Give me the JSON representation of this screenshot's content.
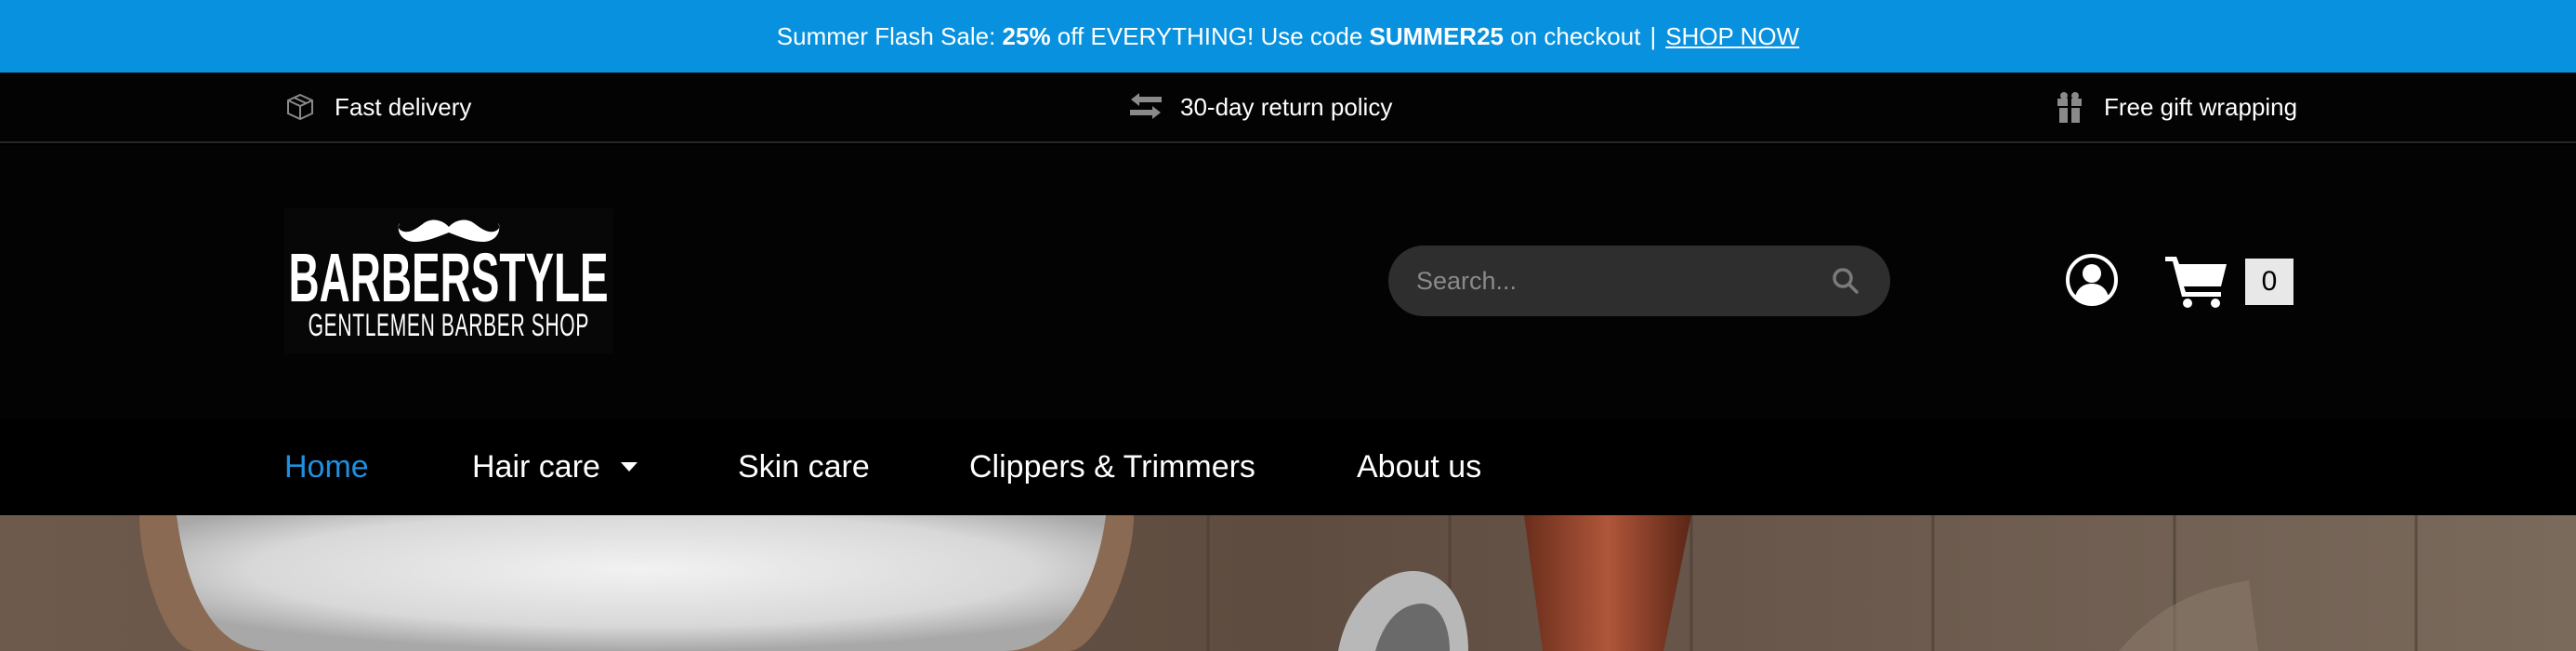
{
  "promo": {
    "prefix": "Summer Flash Sale: ",
    "discount": "25%",
    "middle": " off EVERYTHING! Use code ",
    "code": "SUMMER25",
    "suffix": " on checkout",
    "separator": "|",
    "link": "SHOP NOW",
    "bg_color": "#0891de"
  },
  "features": [
    {
      "label": "Fast delivery",
      "icon": "box-icon"
    },
    {
      "label": "30-day return policy",
      "icon": "arrows-exchange-icon"
    },
    {
      "label": "Free gift wrapping",
      "icon": "gift-icon"
    }
  ],
  "logo": {
    "brand": "BARBERSTYLE",
    "tagline": "GENTLEMEN BARBER SHOP"
  },
  "search": {
    "placeholder": "Search..."
  },
  "cart": {
    "count": "0"
  },
  "nav": {
    "items": [
      {
        "label": "Home",
        "active": true
      },
      {
        "label": "Hair care",
        "has_dropdown": true
      },
      {
        "label": "Skin care"
      },
      {
        "label": "Clippers & Trimmers"
      },
      {
        "label": "About us"
      }
    ],
    "active_color": "#1e90e0"
  }
}
